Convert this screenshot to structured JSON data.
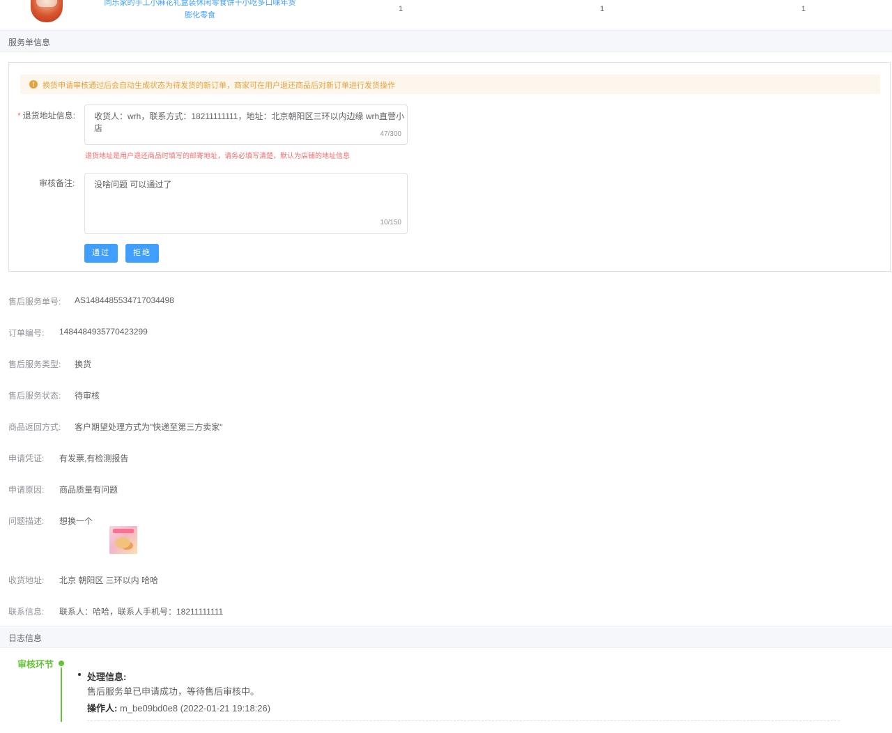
{
  "product": {
    "name": "同乐家的手工小麻花礼盒装休闲零食饼干小吃多口味年货膨化零食",
    "col1": "1",
    "col2": "1",
    "col3": "1"
  },
  "sections": {
    "service_info": "服务单信息",
    "log_info": "日志信息"
  },
  "review_form": {
    "alert": "换货申请审核通过后会自动生成状态为待发货的新订单，商家可在用户退还商品后对新订单进行发货操作",
    "alert_icon": "!",
    "required_mark": "*",
    "return_address_label": "退货地址信息:",
    "return_address_value": "收货人：wrh，联系方式：18211111111，地址：北京朝阳区三环以内边缘 wrh直营小店",
    "return_address_counter": "47/300",
    "return_address_hint": "退货地址是用户退还商品时填写的邮寄地址，请务必填写清楚，默认为店铺的地址信息",
    "remark_label": "审核备注:",
    "remark_value": "没啥问题 可以通过了",
    "remark_counter": "10/150",
    "approve_button": "通过",
    "reject_button": "拒绝"
  },
  "info": {
    "service_no": {
      "label": "售后服务单号:",
      "value": "AS1484485534717034498"
    },
    "order_no": {
      "label": "订单编号:",
      "value": "1484484935770423299"
    },
    "service_type": {
      "label": "售后服务类型:",
      "value": "换货"
    },
    "service_status": {
      "label": "售后服务状态:",
      "value": "待审核"
    },
    "return_method": {
      "label": "商品返回方式:",
      "value": "客户期望处理方式为\"快递至第三方卖家\""
    },
    "evidence": {
      "label": "申请凭证:",
      "value": "有发票,有检测报告"
    },
    "reason": {
      "label": "申请原因:",
      "value": "商品质量有问题"
    },
    "description": {
      "label": "问题描述:",
      "value": "想换一个"
    },
    "shipping_address": {
      "label": "收货地址:",
      "value": "北京 朝阳区 三环以内 哈哈"
    },
    "contact": {
      "label": "联系信息:",
      "value": "联系人：哈哈，联系人手机号：18211111111"
    }
  },
  "log": {
    "stage": "审核环节",
    "title": "处理信息:",
    "message": "售后服务单已申请成功，等待售后审核中。",
    "operator_label": "操作人:",
    "operator_value": "m_be09bd0e8 (2022-01-21 19:18:26)"
  },
  "colors": {
    "primary": "#409eff",
    "warning": "#e6a23c",
    "danger": "#f56c6c",
    "success": "#67c23a"
  }
}
